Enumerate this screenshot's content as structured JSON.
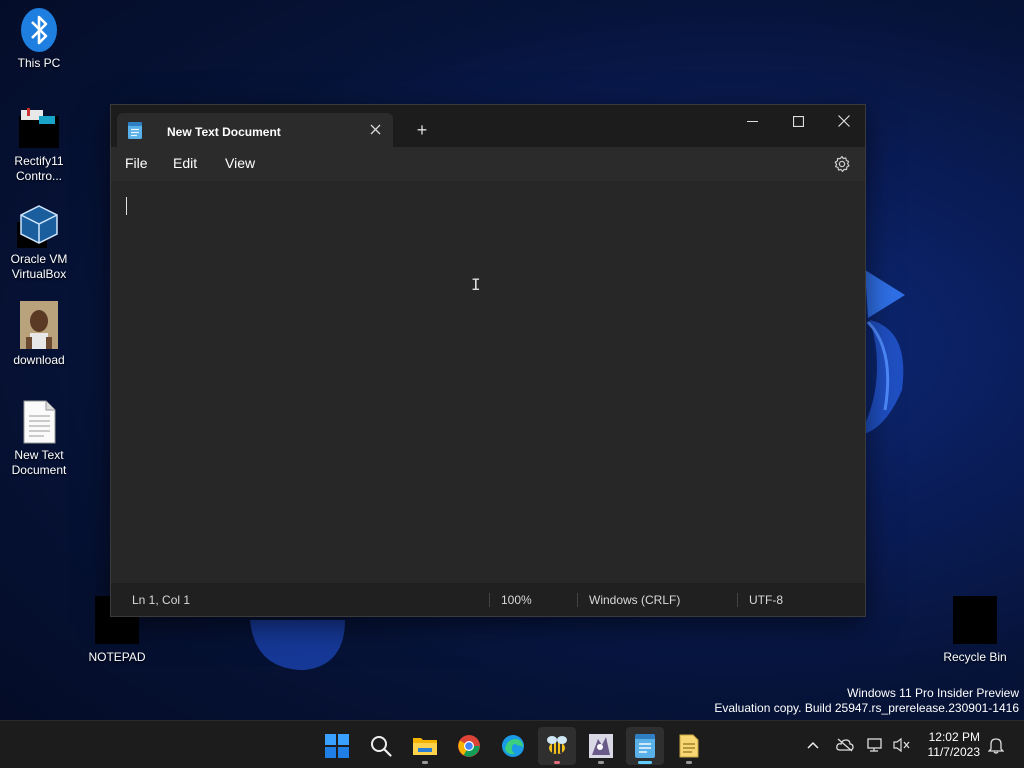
{
  "desktop": {
    "icons": [
      {
        "label": "This PC",
        "icon": "bluetooth-icon"
      },
      {
        "label": "Rectify11 Contro...",
        "icon": "control-panel-icon"
      },
      {
        "label": "Oracle VM VirtualBox",
        "icon": "virtualbox-icon"
      },
      {
        "label": "download",
        "icon": "image-file-icon"
      },
      {
        "label": "New Text Document",
        "icon": "text-file-icon"
      },
      {
        "label": "NOTEPAD",
        "icon": "notepad-shortcut-icon"
      },
      {
        "label": "Recycle Bin",
        "icon": "recycle-bin-icon"
      }
    ]
  },
  "window": {
    "tab_title": "New Text Document",
    "new_tab_symbol": "+",
    "menu": {
      "file": "File",
      "edit": "Edit",
      "view": "View"
    },
    "editor_text": "",
    "status": {
      "position": "Ln 1, Col 1",
      "zoom": "100%",
      "line_ending": "Windows (CRLF)",
      "encoding": "UTF-8"
    },
    "colors": {
      "background": "#202020",
      "editor": "#272727",
      "accent": "#60cdff"
    }
  },
  "watermark": {
    "line1": "Windows 11 Pro Insider Preview",
    "line2": "Evaluation copy. Build 25947.rs_prerelease.230901-1416"
  },
  "taskbar": {
    "apps": [
      "start-icon",
      "search-icon",
      "file-explorer-icon",
      "chrome-icon",
      "edge-icon",
      "bee-app-icon",
      "gnu-app-icon",
      "notepad-icon",
      "notes-file-icon"
    ],
    "active_app": "notepad-icon",
    "clock": {
      "time": "12:02 PM",
      "date": "11/7/2023"
    }
  }
}
